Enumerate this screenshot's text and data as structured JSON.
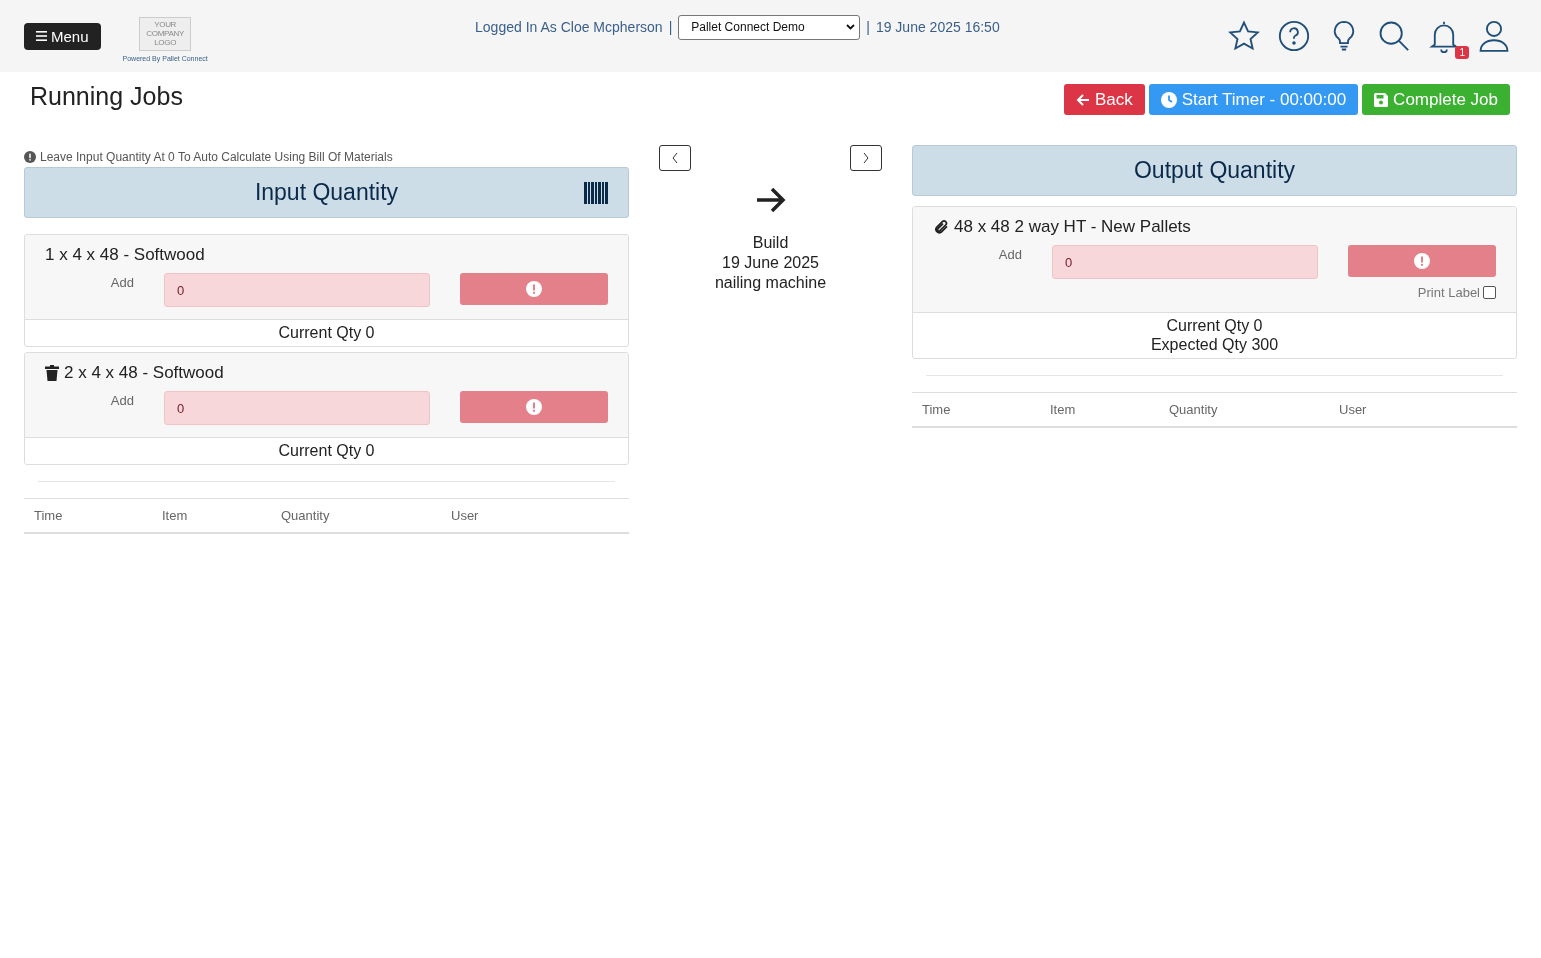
{
  "header": {
    "menu_button": "Menu",
    "logo_lines": [
      "YOUR",
      "COMPANY",
      "LOGO"
    ],
    "powered_by": "Powered By Pallet Connect",
    "logged_in": "Logged In As Cloe Mcpherson",
    "separator_1": "|",
    "site_select": "Pallet Connect Demo",
    "separator_2": "|",
    "datetime": "19 June 2025 16:50",
    "notification_count": "1"
  },
  "page_title": "Running Jobs",
  "actions": [
    {
      "kind": "back",
      "label": "Back"
    },
    {
      "kind": "timer",
      "label": "Start Timer - 00:00:00"
    },
    {
      "kind": "complete",
      "label": "Complete Job"
    }
  ],
  "input": {
    "hint": "Leave Input Quantity At 0 To Auto Calculate Using Bill Of Materials",
    "title": "Input Quantity",
    "items": [
      {
        "kind": "plain",
        "name": "1 x 4 x 48 - Softwood",
        "add_label": "Add",
        "value": "0",
        "current_qty": "Current Qty 0"
      },
      {
        "kind": "removable",
        "name": "2 x 4 x 48 - Softwood",
        "add_label": "Add",
        "value": "0",
        "current_qty": "Current Qty 0"
      }
    ],
    "log_columns": [
      "Time",
      "Item",
      "Quantity",
      "User"
    ]
  },
  "middle": {
    "lines": [
      "Build",
      "19 June 2025",
      "nailing machine"
    ]
  },
  "output": {
    "title": "Output Quantity",
    "items": [
      {
        "kind": "attached",
        "name": "48 x 48 2 way HT - New Pallets",
        "add_label": "Add",
        "value": "0",
        "print_label": {
          "label": "Print Label",
          "checked": false
        },
        "current_qty": "Current Qty 0",
        "expected_qty": "Expected Qty 300"
      }
    ],
    "log_columns": [
      "Time",
      "Item",
      "Quantity",
      "User"
    ]
  }
}
